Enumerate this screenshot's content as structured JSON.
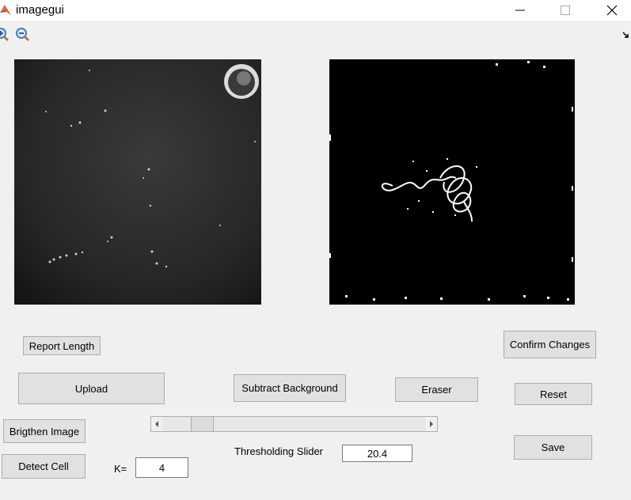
{
  "window": {
    "title": "imagegui",
    "icons": {
      "app": "matlab-logo-icon",
      "minimize": "minimize-icon",
      "maximize": "maximize-icon",
      "close": "close-icon"
    }
  },
  "toolbar": {
    "icons": [
      "zoom-in-icon",
      "zoom-out-icon",
      "toolbar-dock-arrow-icon"
    ]
  },
  "axes": {
    "left": "original-micrograph",
    "right": "thresholded-binary-image"
  },
  "buttons": {
    "report_length": "Report Length",
    "confirm_changes": "Confirm Changes",
    "upload": "Upload",
    "subtract_background": "Subtract Background",
    "eraser": "Eraser",
    "reset": "Reset",
    "brighten_image": "Brigthen Image",
    "save": "Save",
    "detect_cell": "Detect Cell"
  },
  "labels": {
    "thresholding_slider": "Thresholding Slider",
    "k": "K="
  },
  "fields": {
    "threshold_value": "20.4",
    "k_value": "4"
  },
  "slider": {
    "position_fraction": 0.12
  }
}
